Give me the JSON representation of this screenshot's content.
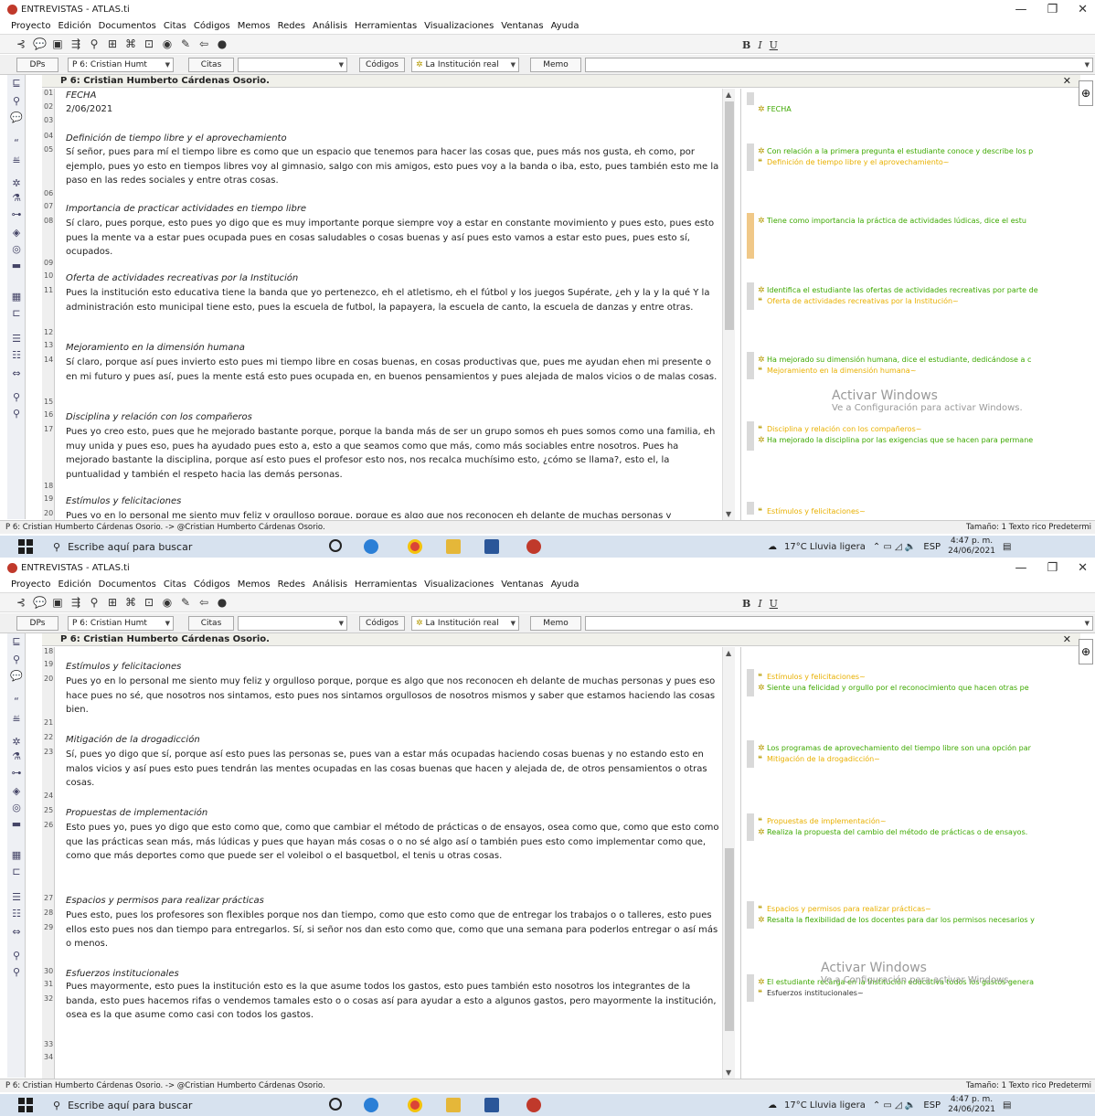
{
  "app": {
    "title": "ENTREVISTAS - ATLAS.ti",
    "menu": [
      "Proyecto",
      "Edición",
      "Documentos",
      "Citas",
      "Códigos",
      "Memos",
      "Redes",
      "Análisis",
      "Herramientas",
      "Visualizaciones",
      "Ventanas",
      "Ayuda"
    ],
    "toolbar_fmt": [
      "B",
      "I",
      "U"
    ],
    "toolbar2": {
      "dps_label": "DPs",
      "doc_select": "P 6: Cristian Humt",
      "citas_label": "Citas",
      "codigos_label": "Códigos",
      "code_select": "La Institución real",
      "memo_label": "Memo"
    },
    "doc_header": "P 6: Cristian Humberto Cárdenas Osorio.",
    "status_left": "P 6: Cristian Humberto Cárdenas Osorio. -> @Cristian Humberto Cárdenas Osorio.",
    "status_right": "Tamaño: 1  Texto rico  Predetermi",
    "watermark_title": "Activar Windows",
    "watermark_sub": "Ve a Configuración para activar Windows.",
    "taskbar": {
      "search_placeholder": "Escribe aquí para buscar",
      "weather": "17°C  Lluvia ligera",
      "lang": "ESP",
      "time": "4:47 p. m.",
      "date": "24/06/2021"
    }
  },
  "shots": [
    {
      "line_numbers": [
        "01",
        "02",
        "03",
        "04",
        "05",
        "06",
        "07",
        "08",
        "09",
        "10",
        "11",
        "12",
        "13",
        "14",
        "15",
        "16",
        "17",
        "18",
        "19",
        "20"
      ],
      "paragraphs": [
        {
          "heading": true,
          "text": "FECHA"
        },
        {
          "heading": false,
          "text": "2/06/2021"
        },
        {
          "heading": true,
          "text": "Definición de tiempo libre y el aprovechamiento"
        },
        {
          "heading": false,
          "text": "Sí señor, pues para mí el tiempo libre es como que un espacio que tenemos para hacer las cosas que, pues más nos gusta, eh como, por ejemplo, pues yo esto en tiempos libres voy al gimnasio, salgo con mis amigos, esto pues voy a la banda o iba, esto, pues también esto me la paso en las redes sociales y entre otras cosas."
        },
        {
          "heading": true,
          "text": "Importancia de practicar actividades en tiempo libre"
        },
        {
          "heading": false,
          "text": "Sí claro, pues porque, esto pues yo digo que es muy importante porque siempre voy a estar en constante movimiento y pues esto, pues esto pues la mente va a estar pues ocupada pues en cosas saludables o cosas buenas y así pues esto vamos a estar esto pues, pues esto sí, ocupados."
        },
        {
          "heading": true,
          "text": "Oferta de actividades recreativas por la Institución"
        },
        {
          "heading": false,
          "text": "Pues la institución esto educativa tiene la banda que yo pertenezco, eh el atletismo, eh el fútbol y los juegos Supérate, ¿eh y la y la qué Y la administración esto municipal tiene esto, pues la escuela de futbol, la papayera, la escuela de canto, la escuela de danzas y entre otras."
        },
        {
          "heading": true,
          "text": "Mejoramiento en la dimensión humana"
        },
        {
          "heading": false,
          "text": "Sí claro, porque así pues invierto esto pues mi tiempo libre en cosas buenas, en cosas productivas que, pues me ayudan ehen mi presente o en mi futuro y pues así, pues la mente está esto pues ocupada en, en buenos pensamientos y pues alejada de malos vicios o de malas cosas."
        },
        {
          "heading": true,
          "text": "Disciplina y relación con los compañeros"
        },
        {
          "heading": false,
          "text": "Pues yo creo esto, pues que he mejorado bastante porque, porque la banda más de ser un grupo somos eh pues somos como una familia, eh muy unida y pues eso, pues ha ayudado pues esto a, esto a que seamos como que más, como más sociables entre nosotros. Pues ha mejorado bastante la disciplina, porque así esto pues el profesor esto nos, nos recalca muchísimo esto, ¿cómo se llama?, esto el, la puntualidad y también el respeto hacia las demás personas."
        },
        {
          "heading": true,
          "text": "Estímulos y felicitaciones"
        },
        {
          "heading": false,
          "text": "Pues yo en lo personal me siento muy feliz y orgulloso porque, porque es algo que nos reconocen eh delante de muchas personas y"
        }
      ],
      "margin": [
        {
          "kind": "code",
          "text": "FECHA"
        },
        {
          "kind": "code",
          "text": "Con relación a la primera pregunta el estudiante conoce y describe los p"
        },
        {
          "kind": "quo",
          "text": "Definición de tiempo libre y el aprovechamiento~"
        },
        {
          "kind": "code",
          "text": "Tiene como importancia la práctica de actividades lúdicas, dice el estu"
        },
        {
          "kind": "code",
          "text": "Identifica el estudiante las ofertas de actividades recreativas por parte de"
        },
        {
          "kind": "quo",
          "text": "Oferta de actividades recreativas por la Institución~"
        },
        {
          "kind": "code",
          "text": "Ha mejorado su dimensión humana, dice el estudiante, dedicándose a c"
        },
        {
          "kind": "quo",
          "text": "Mejoramiento en la dimensión humana~"
        },
        {
          "kind": "quo",
          "text": "Disciplina y relación con los compañeros~"
        },
        {
          "kind": "code",
          "text": "Ha mejorado la disciplina por las exigencias que se hacen para permane"
        },
        {
          "kind": "quo",
          "text": "Estímulos y felicitaciones~"
        }
      ]
    },
    {
      "line_numbers": [
        "18",
        "19",
        "20",
        "21",
        "22",
        "23",
        "24",
        "25",
        "26",
        "27",
        "28",
        "29",
        "30",
        "31",
        "32",
        "33",
        "34"
      ],
      "paragraphs": [
        {
          "heading": true,
          "text": "Estímulos y felicitaciones"
        },
        {
          "heading": false,
          "text": "Pues yo en lo personal me siento muy feliz y orgulloso porque, porque es algo que nos reconocen eh delante de muchas personas y pues eso hace pues no sé, que nosotros nos sintamos, esto pues nos sintamos orgullosos de nosotros mismos y saber que estamos haciendo las cosas bien."
        },
        {
          "heading": true,
          "text": "Mitigación de la drogadicción"
        },
        {
          "heading": false,
          "text": "Sí, pues yo digo que sí, porque así esto pues las personas se, pues van a estar más ocupadas haciendo cosas buenas y no estando esto en malos vicios y así pues esto pues tendrán las mentes ocupadas en las cosas buenas que hacen y alejada de, de otros pensamientos o otras cosas."
        },
        {
          "heading": true,
          "text": "Propuestas de implementación"
        },
        {
          "heading": false,
          "text": "Esto pues yo, pues yo digo que esto como que, como que cambiar el método de prácticas o de ensayos, osea como que, como que esto como que las prácticas sean más, más lúdicas y pues que hayan más cosas o o no sé algo así o también pues esto como implementar como que, como que más deportes como que puede ser el voleibol o el basquetbol, el tenis u otras cosas."
        },
        {
          "heading": true,
          "text": "Espacios y permisos para realizar prácticas"
        },
        {
          "heading": false,
          "text": "Pues esto, pues los profesores son flexibles porque nos dan tiempo, como que esto como que de entregar los trabajos o o talleres, esto pues ellos esto pues nos dan tiempo para entregarlos. Sí, si señor nos dan esto como que, como que una semana para poderlos entregar o así más o menos."
        },
        {
          "heading": true,
          "text": "Esfuerzos institucionales"
        },
        {
          "heading": false,
          "text": "Pues mayormente, esto pues la institución esto es la que asume todos los gastos, esto pues también esto nosotros los integrantes de la banda, esto pues hacemos rifas o vendemos tamales esto o o cosas así para ayudar a esto a algunos gastos, pero mayormente la institución, osea es la que asume como casi con todos los gastos."
        }
      ],
      "margin": [
        {
          "kind": "quo",
          "text": "Estímulos y felicitaciones~"
        },
        {
          "kind": "code",
          "text": "Siente una felicidad y orgullo por el reconocimiento que hacen otras pe"
        },
        {
          "kind": "code",
          "text": "Los programas de aprovechamiento del tiempo libre son una opción par"
        },
        {
          "kind": "quo",
          "text": "Mitigación de la drogadicción~"
        },
        {
          "kind": "quo",
          "text": "Propuestas de implementación~"
        },
        {
          "kind": "code",
          "text": "Realiza la propuesta del cambio del método de prácticas o de ensayos."
        },
        {
          "kind": "quo",
          "text": "Espacios y permisos para realizar prácticas~"
        },
        {
          "kind": "code",
          "text": "Resalta la flexibilidad de los docentes para dar los permisos necesarios y"
        },
        {
          "kind": "code",
          "text": "El estudiante recarga en la Institución educativa todos los gastos genera"
        },
        {
          "kind": "plain",
          "text": "Esfuerzos institucionales~"
        }
      ]
    }
  ]
}
